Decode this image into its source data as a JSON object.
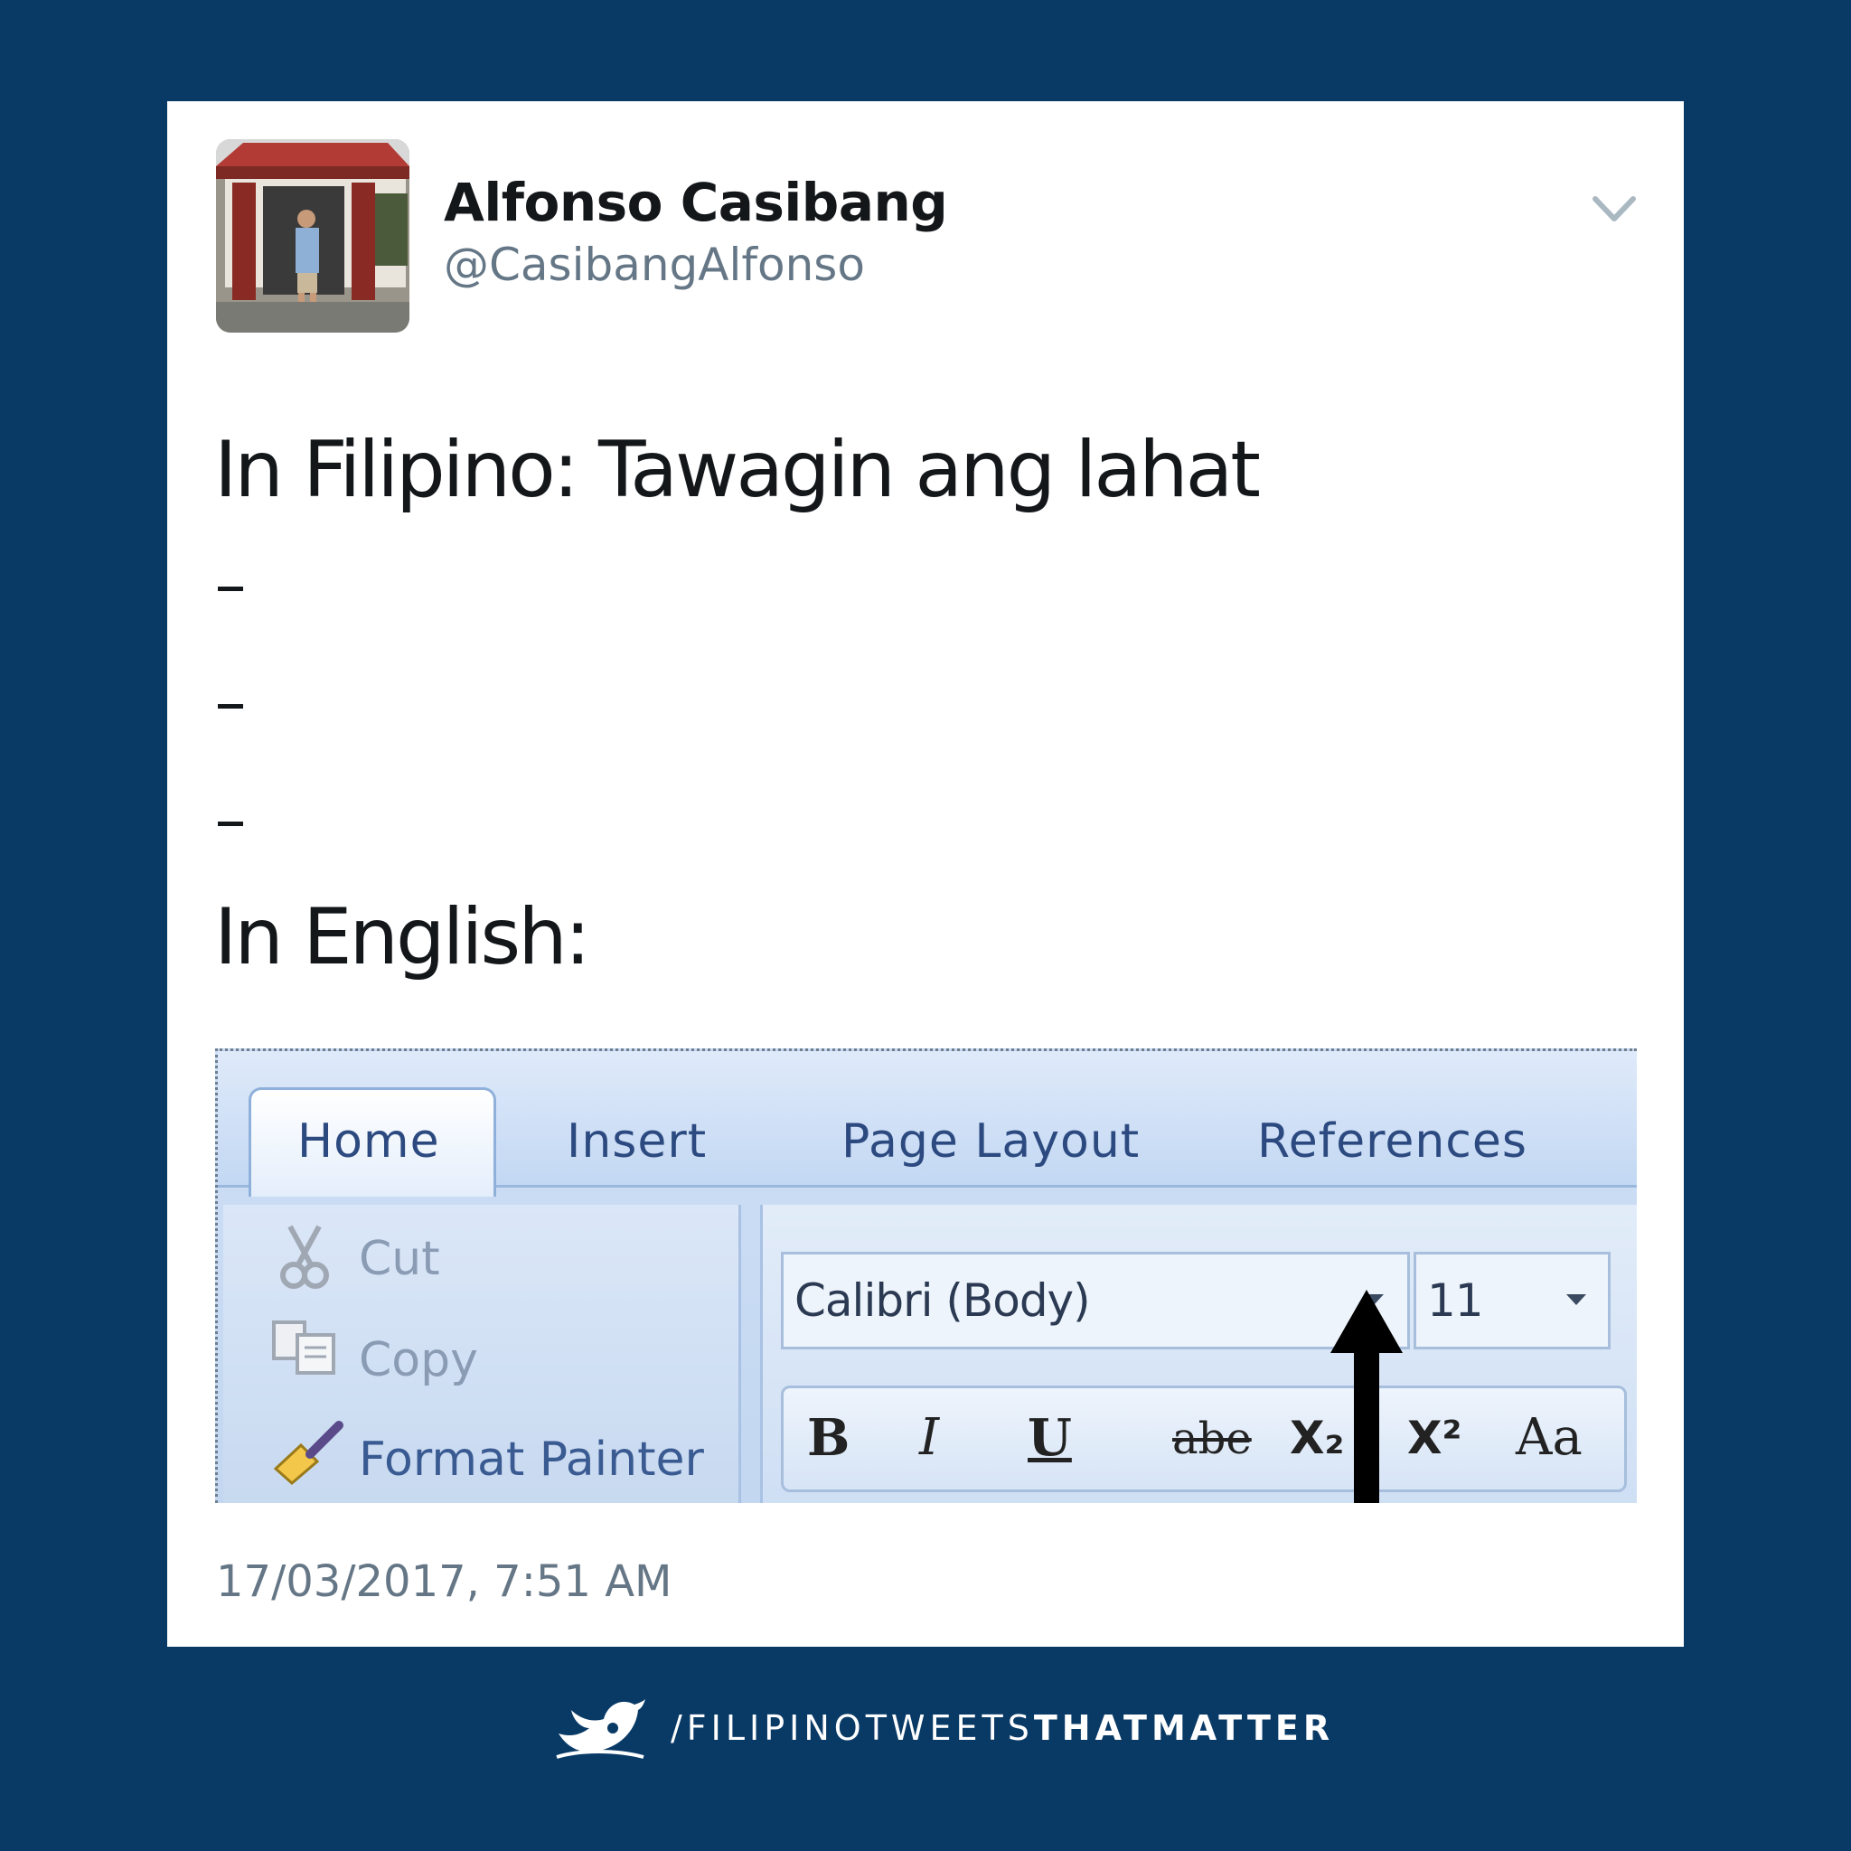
{
  "tweet": {
    "display_name": "Alfonso Casibang",
    "handle": "@CasibangAlfonso",
    "line1": "In Filipino: Tawagin ang lahat",
    "line2": "In English:",
    "timestamp": "17/03/2017, 7:51 AM"
  },
  "word_ribbon": {
    "tabs": [
      "Home",
      "Insert",
      "Page Layout",
      "References"
    ],
    "clipboard": [
      "Cut",
      "Copy",
      "Format Painter"
    ],
    "font_name": "Calibri (Body)",
    "font_size": "11",
    "format_buttons": [
      "B",
      "I",
      "U",
      "abe",
      "X₂",
      "X²",
      "Aa"
    ]
  },
  "footer": {
    "prefix": "/FILIPINOTWEETS",
    "bold": "THATMATTER"
  },
  "colors": {
    "background": "#093a66",
    "card": "#ffffff",
    "ribbon": "#c3d8f3"
  }
}
